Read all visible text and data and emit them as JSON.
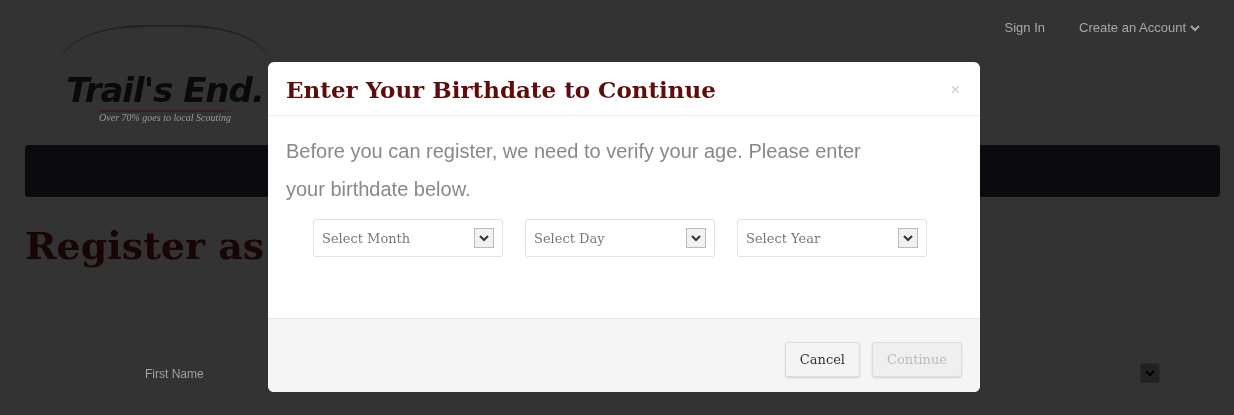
{
  "header": {
    "logo": {
      "name": "Trail's End.",
      "tagline": "Over 70% goes to local Scouting"
    },
    "nav_links": [
      {
        "label": "Sign In",
        "dropdown": false
      },
      {
        "label": "Create an Account",
        "dropdown": true
      }
    ]
  },
  "page": {
    "heading": "Register as",
    "form_rows": [
      {
        "label": "First Name"
      }
    ]
  },
  "modal": {
    "title": "Enter Your Birthdate to Continue",
    "close": "×",
    "message": "Before you can register, we need to verify your age. Please enter your birthdate below.",
    "selects": [
      {
        "placeholder": "Select Month"
      },
      {
        "placeholder": "Select Day"
      },
      {
        "placeholder": "Select Year"
      }
    ],
    "buttons": [
      {
        "label": "Cancel",
        "disabled": false
      },
      {
        "label": "Continue",
        "disabled": true
      }
    ]
  }
}
